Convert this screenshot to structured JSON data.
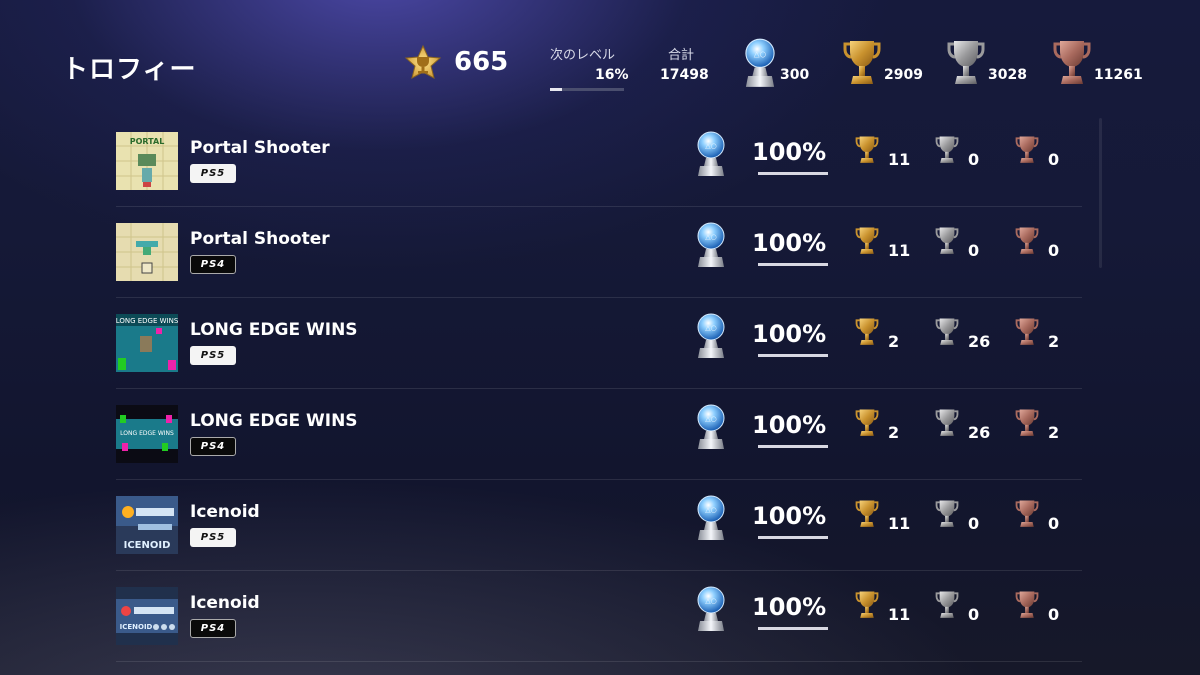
{
  "title": "トロフィー",
  "summary": {
    "level": "665",
    "next_level_label": "次のレベル",
    "next_level_pct": "16%",
    "next_level_progress": 0.16,
    "total_label": "合計",
    "total": "17498",
    "platinum": "300",
    "gold": "2909",
    "silver": "3028",
    "bronze": "11261"
  },
  "colors": {
    "platinum": "#9fd6ff",
    "gold": "#c9922e",
    "silver": "#9a9a9a",
    "bronze": "#a96a5e"
  },
  "games": [
    {
      "name": "Portal Shooter",
      "platform": "PS5",
      "percent": "100%",
      "gold": "11",
      "silver": "0",
      "bronze": "0"
    },
    {
      "name": "Portal Shooter",
      "platform": "PS4",
      "percent": "100%",
      "gold": "11",
      "silver": "0",
      "bronze": "0"
    },
    {
      "name": "LONG EDGE WINS",
      "platform": "PS5",
      "percent": "100%",
      "gold": "2",
      "silver": "26",
      "bronze": "2"
    },
    {
      "name": "LONG EDGE WINS",
      "platform": "PS4",
      "percent": "100%",
      "gold": "2",
      "silver": "26",
      "bronze": "2"
    },
    {
      "name": "Icenoid",
      "platform": "PS5",
      "percent": "100%",
      "gold": "11",
      "silver": "0",
      "bronze": "0"
    },
    {
      "name": "Icenoid",
      "platform": "PS4",
      "percent": "100%",
      "gold": "11",
      "silver": "0",
      "bronze": "0"
    }
  ]
}
